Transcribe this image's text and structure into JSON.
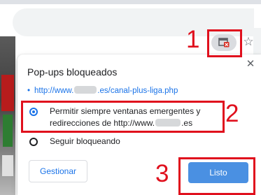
{
  "popup": {
    "title": "Pop-ups bloqueados",
    "blocked_url": {
      "prefix": "http://www.",
      "suffix": ".es/canal-plus-liga.php"
    },
    "options": [
      {
        "line1": "Permitir siempre ventanas emergentes y",
        "line2_prefix": "redirecciones de http://www.",
        "line2_suffix": ".es",
        "selected": true
      },
      {
        "label": "Seguir bloqueando",
        "selected": false
      }
    ],
    "manage_label": "Gestionar",
    "done_label": "Listo"
  },
  "annotations": {
    "step1": "1",
    "step2": "2",
    "step3": "3"
  },
  "icons": {
    "popup_blocked": "popup-blocked-icon",
    "bookmark": "star-icon",
    "close": "close-icon",
    "close_glyph": "✕",
    "star_glyph": "☆",
    "bullet": "•"
  },
  "colors": {
    "accent": "#1a73e8",
    "done_button": "#4a90e2",
    "annotation_red": "#e0101d"
  }
}
